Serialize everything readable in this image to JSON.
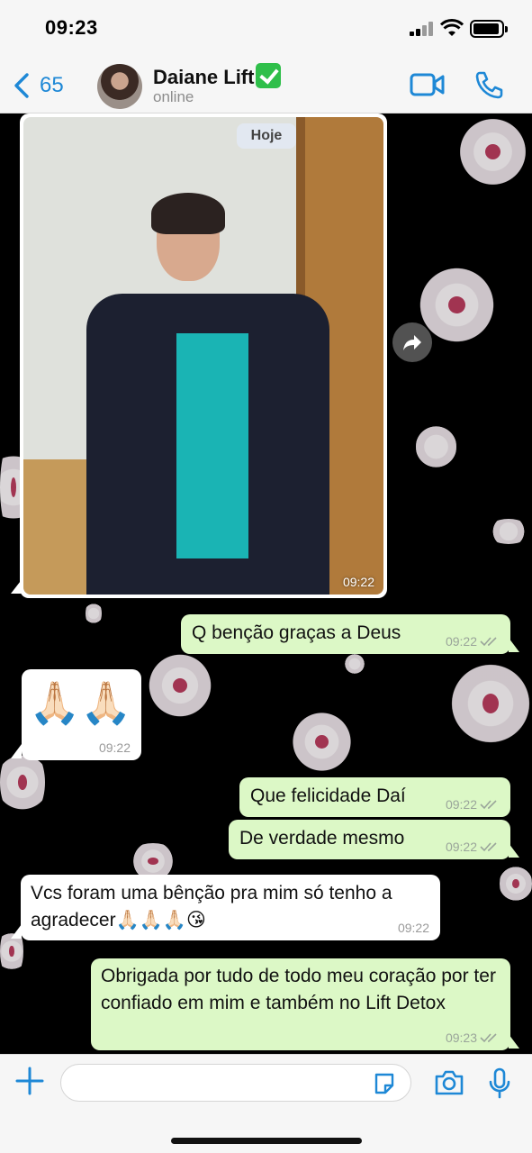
{
  "status_bar": {
    "time": "09:23"
  },
  "header": {
    "back_count": "65",
    "contact_name": "Daiane Lift",
    "contact_status": "online"
  },
  "chat": {
    "date_label": "Hoje",
    "photo_time": "09:22",
    "messages": [
      {
        "direction": "out",
        "text": "Q benção graças a Deus",
        "time": "09:22"
      },
      {
        "direction": "in",
        "text": "🙏🏻🙏🏻",
        "time": "09:22"
      },
      {
        "direction": "out",
        "text": "Que felicidade Daí",
        "time": "09:22"
      },
      {
        "direction": "out",
        "text": "De verdade mesmo",
        "time": "09:22"
      },
      {
        "direction": "in",
        "text": "Vcs foram uma bênção pra mim só tenho a agradecer🙏🏻🙏🏻🙏🏻😘",
        "time": "09:22"
      },
      {
        "direction": "out",
        "text": "Obrigada por tudo de todo meu coração por ter confiado em mim e também no Lift Detox",
        "time": "09:23"
      }
    ]
  },
  "composer": {
    "placeholder": ""
  },
  "colors": {
    "accent": "#1e88d6",
    "outgoing_bubble": "#dcf8c6",
    "incoming_bubble": "#ffffff",
    "verified_badge": "#2fbf4a"
  },
  "icons": [
    "back-chevron-icon",
    "verified-check-icon",
    "video-call-icon",
    "phone-icon",
    "forward-icon",
    "double-check-icon",
    "plus-icon",
    "sticker-icon",
    "camera-icon",
    "microphone-icon"
  ]
}
